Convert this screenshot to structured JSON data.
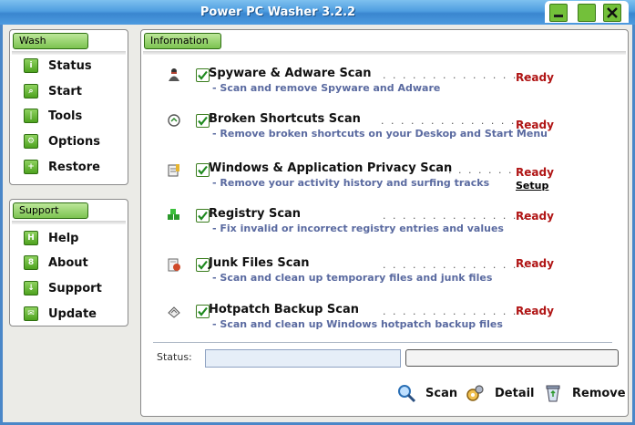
{
  "window": {
    "title": "Power PC Washer 3.2.2"
  },
  "wash": {
    "header": "Wash",
    "items": [
      {
        "label": "Status",
        "icon": "status-icon"
      },
      {
        "label": "Start",
        "icon": "start-icon"
      },
      {
        "label": "Tools",
        "icon": "tools-icon"
      },
      {
        "label": "Options",
        "icon": "options-icon"
      },
      {
        "label": "Restore",
        "icon": "restore-icon"
      }
    ]
  },
  "support": {
    "header": "Support",
    "items": [
      {
        "label": "Help",
        "icon": "help-icon"
      },
      {
        "label": "About",
        "icon": "about-icon"
      },
      {
        "label": "Support",
        "icon": "support-icon"
      },
      {
        "label": "Update",
        "icon": "update-icon"
      }
    ]
  },
  "info": {
    "header": "Information",
    "scans": [
      {
        "title": "Spyware & Adware Scan",
        "desc": "- Scan and remove Spyware and Adware",
        "status": "Ready",
        "checked": true,
        "icon": "spy-icon"
      },
      {
        "title": "Broken Shortcuts Scan",
        "desc": "- Remove broken shortcuts on your Deskop and Start Menu",
        "status": "Ready",
        "checked": true,
        "icon": "shortcut-icon"
      },
      {
        "title": "Windows & Application Privacy Scan",
        "desc": "- Remove your activity history and surfing tracks",
        "status": "Ready",
        "checked": true,
        "icon": "privacy-icon",
        "link": "Setup"
      },
      {
        "title": "Registry Scan",
        "desc": "- Fix invalid or incorrect registry entries and values",
        "status": "Ready",
        "checked": true,
        "icon": "registry-icon"
      },
      {
        "title": "Junk Files Scan",
        "desc": "- Scan and clean up temporary files and junk files",
        "status": "Ready",
        "checked": true,
        "icon": "junk-files-icon"
      },
      {
        "title": "Hotpatch Backup Scan",
        "desc": "- Scan and clean up Windows hotpatch backup files",
        "status": "Ready",
        "checked": true,
        "icon": "hotpatch-icon"
      }
    ]
  },
  "status": {
    "label": "Status:",
    "value": "",
    "progress": 0
  },
  "actions": {
    "scan": "Scan",
    "detail": "Detail",
    "remove": "Remove"
  },
  "colors": {
    "accent": "#7cc350",
    "title_bar": "#4f9ee0",
    "ready": "#b01414",
    "desc": "#5a6aa0"
  }
}
